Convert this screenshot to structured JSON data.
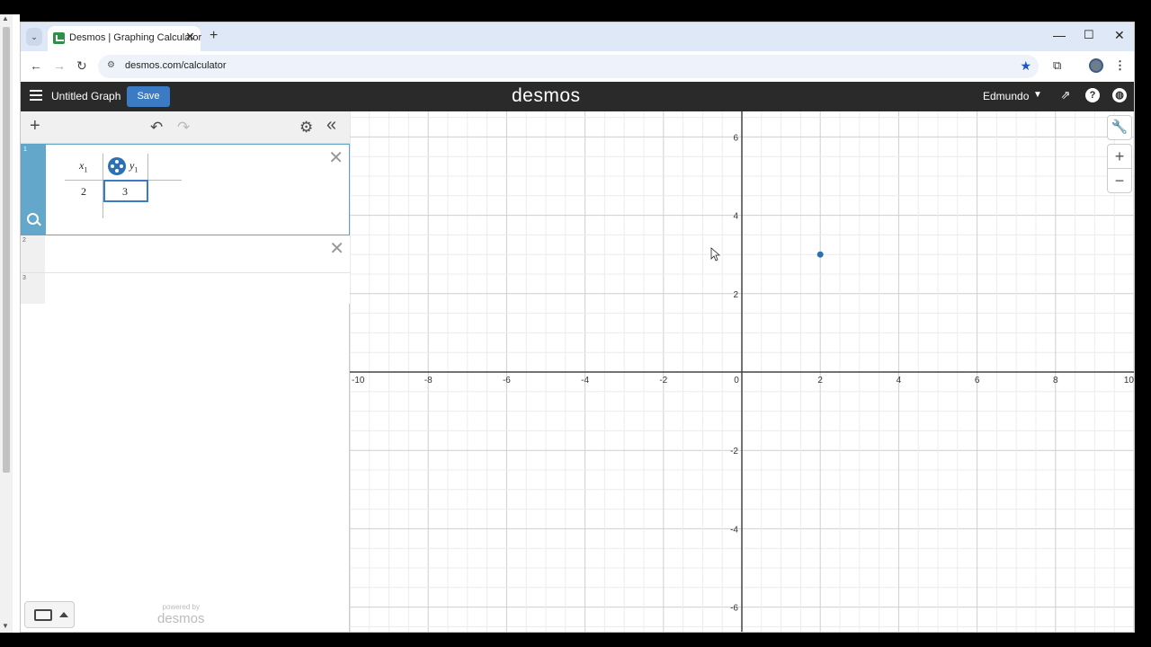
{
  "browser": {
    "tab_title": "Desmos | Graphing Calculator",
    "url": "desmos.com/calculator"
  },
  "desmos": {
    "graph_title": "Untitled Graph",
    "save_label": "Save",
    "logo": "desmos",
    "user": "Edmundo"
  },
  "expressions": {
    "rows": [
      "1",
      "2",
      "3"
    ],
    "table": {
      "col1_header": "x",
      "col1_sub": "1",
      "col2_header": "y",
      "col2_sub": "1",
      "x_value": "2",
      "y_value": "3"
    },
    "powered_by": "powered by",
    "powered_logo": "desmos"
  },
  "graph": {
    "x_range": [
      -10,
      10
    ],
    "y_range": [
      -6.6,
      6.6
    ],
    "x_ticks": [
      "-10",
      "-8",
      "-6",
      "-4",
      "-2",
      "0",
      "2",
      "4",
      "6",
      "8",
      "10"
    ],
    "y_ticks": [
      "6",
      "4",
      "2",
      "-2",
      "-4",
      "-6"
    ],
    "point": {
      "x": 2,
      "y": 3,
      "color": "#2d70b3"
    },
    "grid": true
  }
}
